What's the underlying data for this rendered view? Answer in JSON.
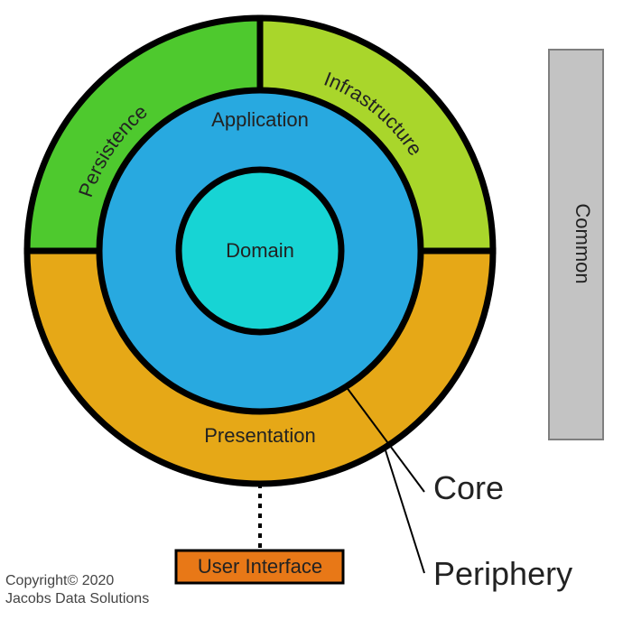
{
  "rings": {
    "outer": {
      "persistence": "Persistence",
      "infrastructure": "Infrastructure",
      "presentation": "Presentation"
    },
    "middle": "Application",
    "inner": "Domain"
  },
  "callouts": {
    "core": "Core",
    "periphery": "Periphery"
  },
  "side_box": "Common",
  "ui_box": "User Interface",
  "copyright_line1": "Copyright© 2020",
  "copyright_line2": "Jacobs Data Solutions",
  "colors": {
    "persistence": "#4ec92e",
    "infrastructure": "#a9d62b",
    "presentation": "#e6a817",
    "application": "#28a9e0",
    "domain": "#17d4d4",
    "ui_box": "#e87817",
    "common": "#c3c3c3"
  }
}
